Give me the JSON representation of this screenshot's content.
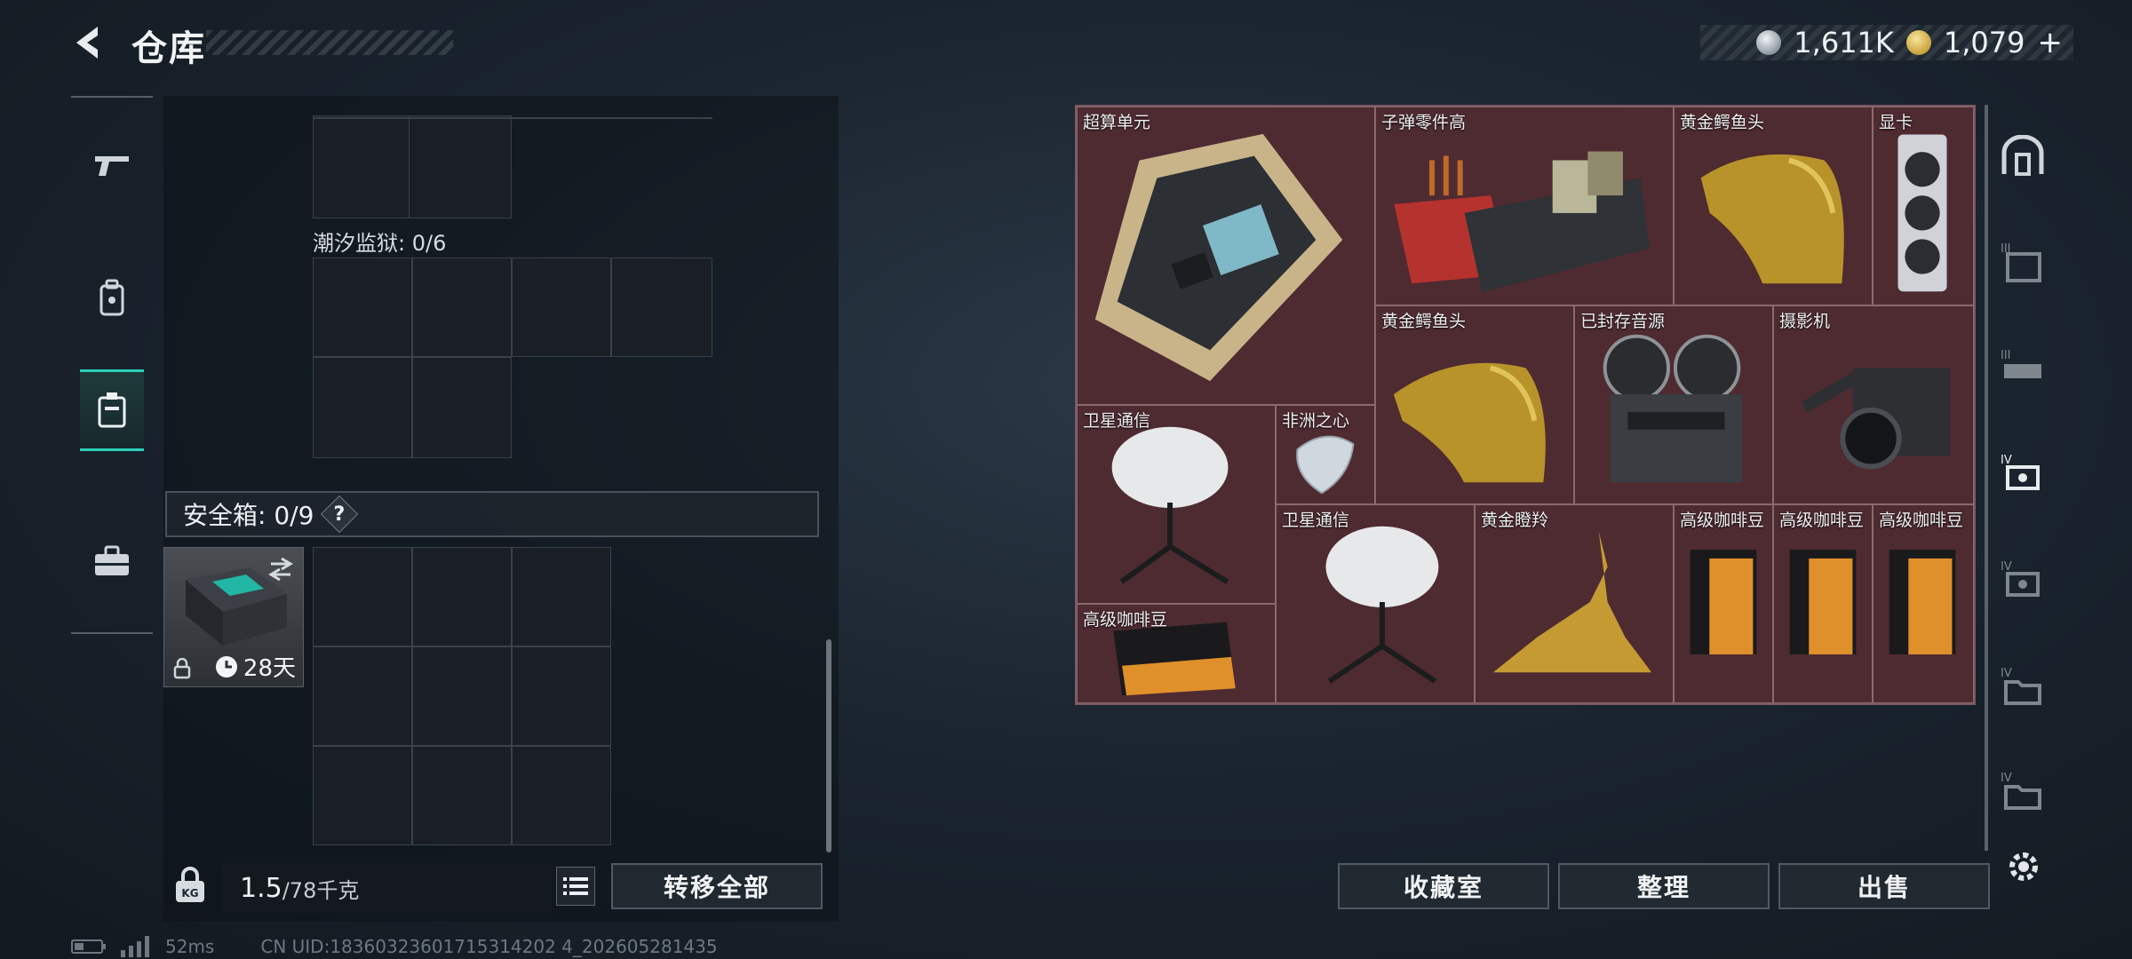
{
  "header": {
    "title": "仓库",
    "currency": [
      {
        "icon": "silver-coin-icon",
        "value": "1,611K"
      },
      {
        "icon": "gold-coin-icon",
        "value": "1,079"
      }
    ],
    "currency_add": "+"
  },
  "left_rail": {
    "items": [
      {
        "icon": "gun-icon",
        "active": false
      },
      {
        "icon": "backpack-icon",
        "active": false
      },
      {
        "icon": "container-icon",
        "active": true
      },
      {
        "icon": "toolbox-icon",
        "active": false
      }
    ]
  },
  "stash": {
    "section_tide_prison": "潮汐监狱: 0/6",
    "safebox_title": "安全箱: 0/9",
    "safebox_help": "?",
    "safebox_item_days": "28天",
    "weight_current": "1.5",
    "weight_max": "/78千克",
    "transfer_all": "转移全部"
  },
  "loot": {
    "items": [
      {
        "label": "超算单元"
      },
      {
        "label": "子弹零件高"
      },
      {
        "label": "黄金鳄鱼头"
      },
      {
        "label": "显卡"
      },
      {
        "label": "黄金鳄鱼头"
      },
      {
        "label": "已封存音源"
      },
      {
        "label": "摄影机"
      },
      {
        "label": "卫星通信"
      },
      {
        "label": "非洲之心"
      },
      {
        "label": "卫星通信"
      },
      {
        "label": "黄金瞪羚"
      },
      {
        "label": "高级咖啡豆"
      },
      {
        "label": "高级咖啡豆"
      },
      {
        "label": "高级咖啡豆"
      },
      {
        "label": "高级咖啡豆"
      }
    ],
    "buttons": {
      "collection": "收藏室",
      "sort": "整理",
      "sell": "出售"
    }
  },
  "right_rail": {
    "tiers": [
      "III",
      "III",
      "IV",
      "IV",
      "IV",
      "IV"
    ]
  },
  "status": {
    "ping": "52ms",
    "uid": "CN UID:18360323601715314202 4_202605281435"
  },
  "colors": {
    "accent": "#2ad0b9",
    "loot_bg": "#4a2c31"
  }
}
